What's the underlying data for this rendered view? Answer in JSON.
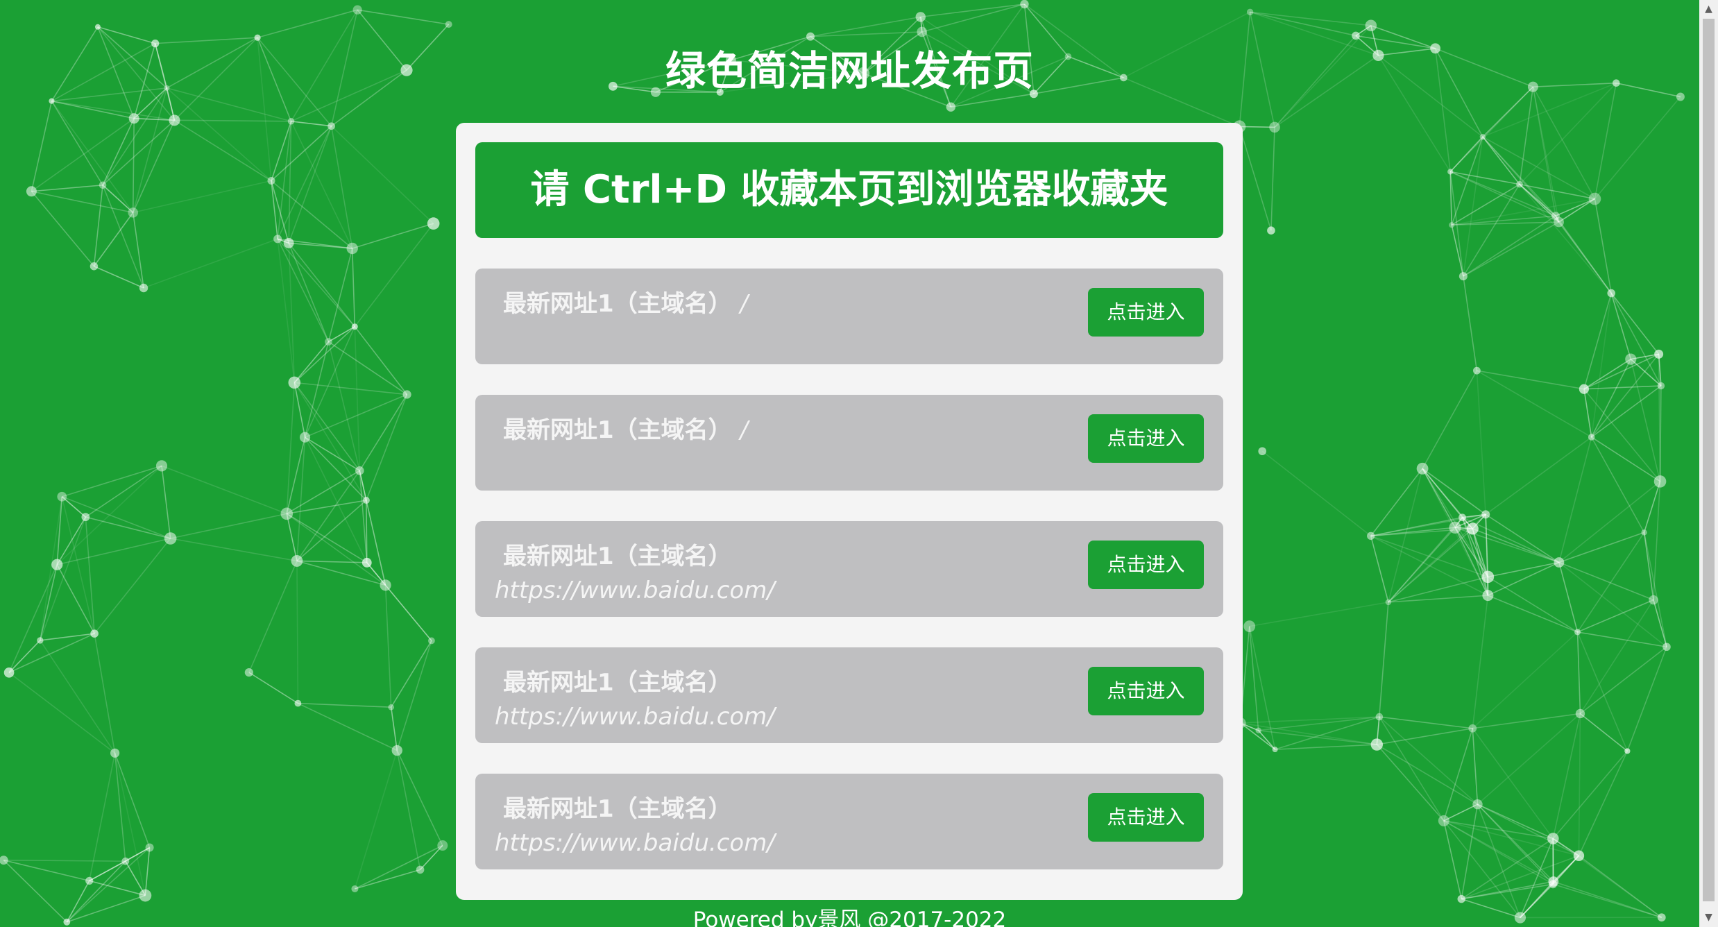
{
  "page": {
    "title": "绿色简洁网址发布页",
    "bookmark_notice": "请 Ctrl+D 收藏本页到浏览器收藏夹",
    "footer": "Powered by景风 @2017-2022"
  },
  "links": [
    {
      "title": "最新网址1（主域名）",
      "slash": "/",
      "url": "",
      "button": "点击进入"
    },
    {
      "title": "最新网址1（主域名）",
      "slash": "/",
      "url": "",
      "button": "点击进入"
    },
    {
      "title": "最新网址1（主域名）",
      "slash": "",
      "url": "https://www.baidu.com/",
      "button": "点击进入"
    },
    {
      "title": "最新网址1（主域名）",
      "slash": "",
      "url": "https://www.baidu.com/",
      "button": "点击进入"
    },
    {
      "title": "最新网址1（主域名）",
      "slash": "",
      "url": "https://www.baidu.com/",
      "button": "点击进入"
    }
  ],
  "scrollbar": {
    "up_icon": "▲",
    "down_icon": "▼"
  },
  "colors": {
    "background": "#1ba034",
    "card": "#f4f4f4",
    "link_row": "#bfbfc1",
    "button": "#1ba034",
    "text": "#ffffff"
  }
}
